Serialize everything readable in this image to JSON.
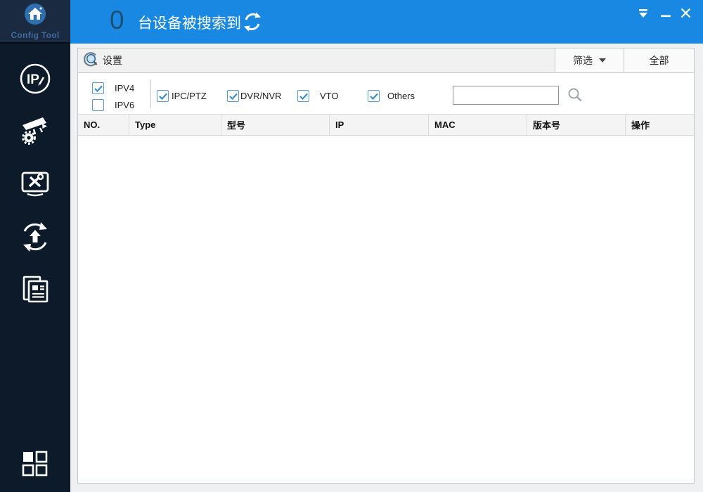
{
  "app": {
    "title": "Config Tool"
  },
  "header": {
    "device_count": "0",
    "device_count_label": "台设备被搜索到"
  },
  "toolbar": {
    "settings_label": "设置",
    "filter_label": "筛选",
    "all_tab_label": "全部"
  },
  "filters": {
    "ip_versions": [
      {
        "label": "IPV4",
        "checked": true
      },
      {
        "label": "IPV6",
        "checked": false
      }
    ],
    "device_types": [
      {
        "label": "IPC/PTZ",
        "checked": true
      },
      {
        "label": "DVR/NVR",
        "checked": true
      },
      {
        "label": "VTO",
        "checked": true
      },
      {
        "label": "Others",
        "checked": true
      }
    ],
    "search": {
      "value": "",
      "placeholder": ""
    }
  },
  "table": {
    "columns": [
      "NO.",
      "Type",
      "型号",
      "IP",
      "MAC",
      "版本号",
      "操作"
    ],
    "rows": []
  },
  "sidebar_icons": [
    "ip-edit-icon",
    "camera-gear-icon",
    "monitor-tools-icon",
    "upgrade-icon",
    "documents-icon",
    "apps-grid-icon"
  ],
  "colors": {
    "accent_blue": "#1888e2",
    "sidebar_dark": "#0c1a2a",
    "count_text": "#1d5174",
    "checkbox_blue": "#5b9bd5"
  }
}
